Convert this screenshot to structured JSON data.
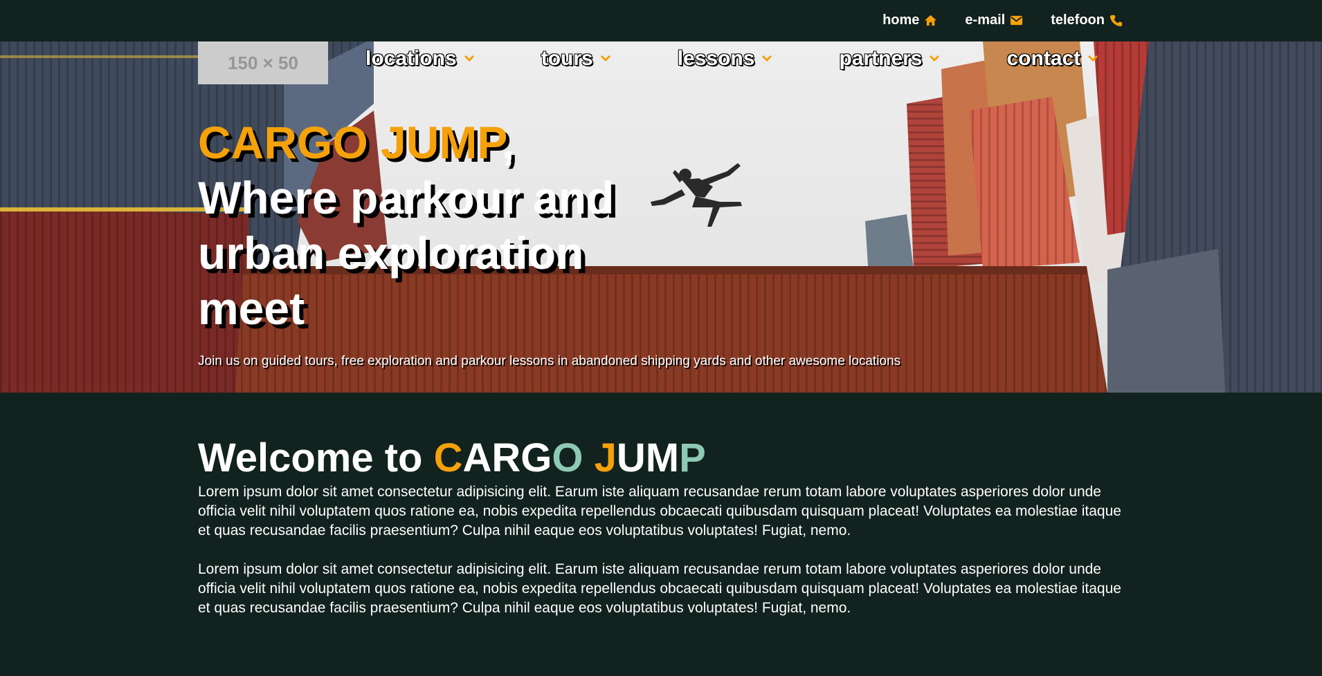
{
  "topbar": {
    "links": [
      {
        "label": "home",
        "icon": "home-icon"
      },
      {
        "label": "e-mail",
        "icon": "mail-icon"
      },
      {
        "label": "telefoon",
        "icon": "phone-icon"
      }
    ]
  },
  "logo": {
    "placeholder_text": "150 × 50"
  },
  "nav": {
    "items": [
      {
        "label": "locations"
      },
      {
        "label": "tours"
      },
      {
        "label": "lessons"
      },
      {
        "label": "partners"
      },
      {
        "label": "contact"
      }
    ]
  },
  "hero": {
    "brand": "CARGO JUMP",
    "comma": ",",
    "tagline": "Where parkour and urban exploration meet",
    "subtitle": "Join us on guided tours, free exploration and parkour lessons in abandoned shipping yards and other awesome locations"
  },
  "welcome": {
    "title_prefix": "Welcome to ",
    "brand_letters": [
      "C",
      "ARG",
      "O",
      " ",
      "J",
      "UM",
      "P"
    ],
    "paragraphs": [
      "Lorem ipsum dolor sit amet consectetur adipisicing elit. Earum iste aliquam recusandae rerum totam labore voluptates asperiores dolor unde officia velit nihil voluptatem quos ratione ea, nobis expedita repellendus obcaecati quibusdam quisquam placeat! Voluptates ea molestiae itaque et quas recusandae facilis praesentium? Culpa nihil eaque eos voluptatibus voluptates! Fugiat, nemo.",
      "Lorem ipsum dolor sit amet consectetur adipisicing elit. Earum iste aliquam recusandae rerum totam labore voluptates asperiores dolor unde officia velit nihil voluptatem quos ratione ea, nobis expedita repellendus obcaecati quibusdam quisquam placeat! Voluptates ea molestiae itaque et quas recusandae facilis praesentium? Culpa nihil eaque eos voluptatibus voluptates! Fugiat, nemo."
    ]
  },
  "colors": {
    "background": "#12221e",
    "accent_orange": "#f5a10a",
    "accent_teal": "#8ec9b4"
  }
}
